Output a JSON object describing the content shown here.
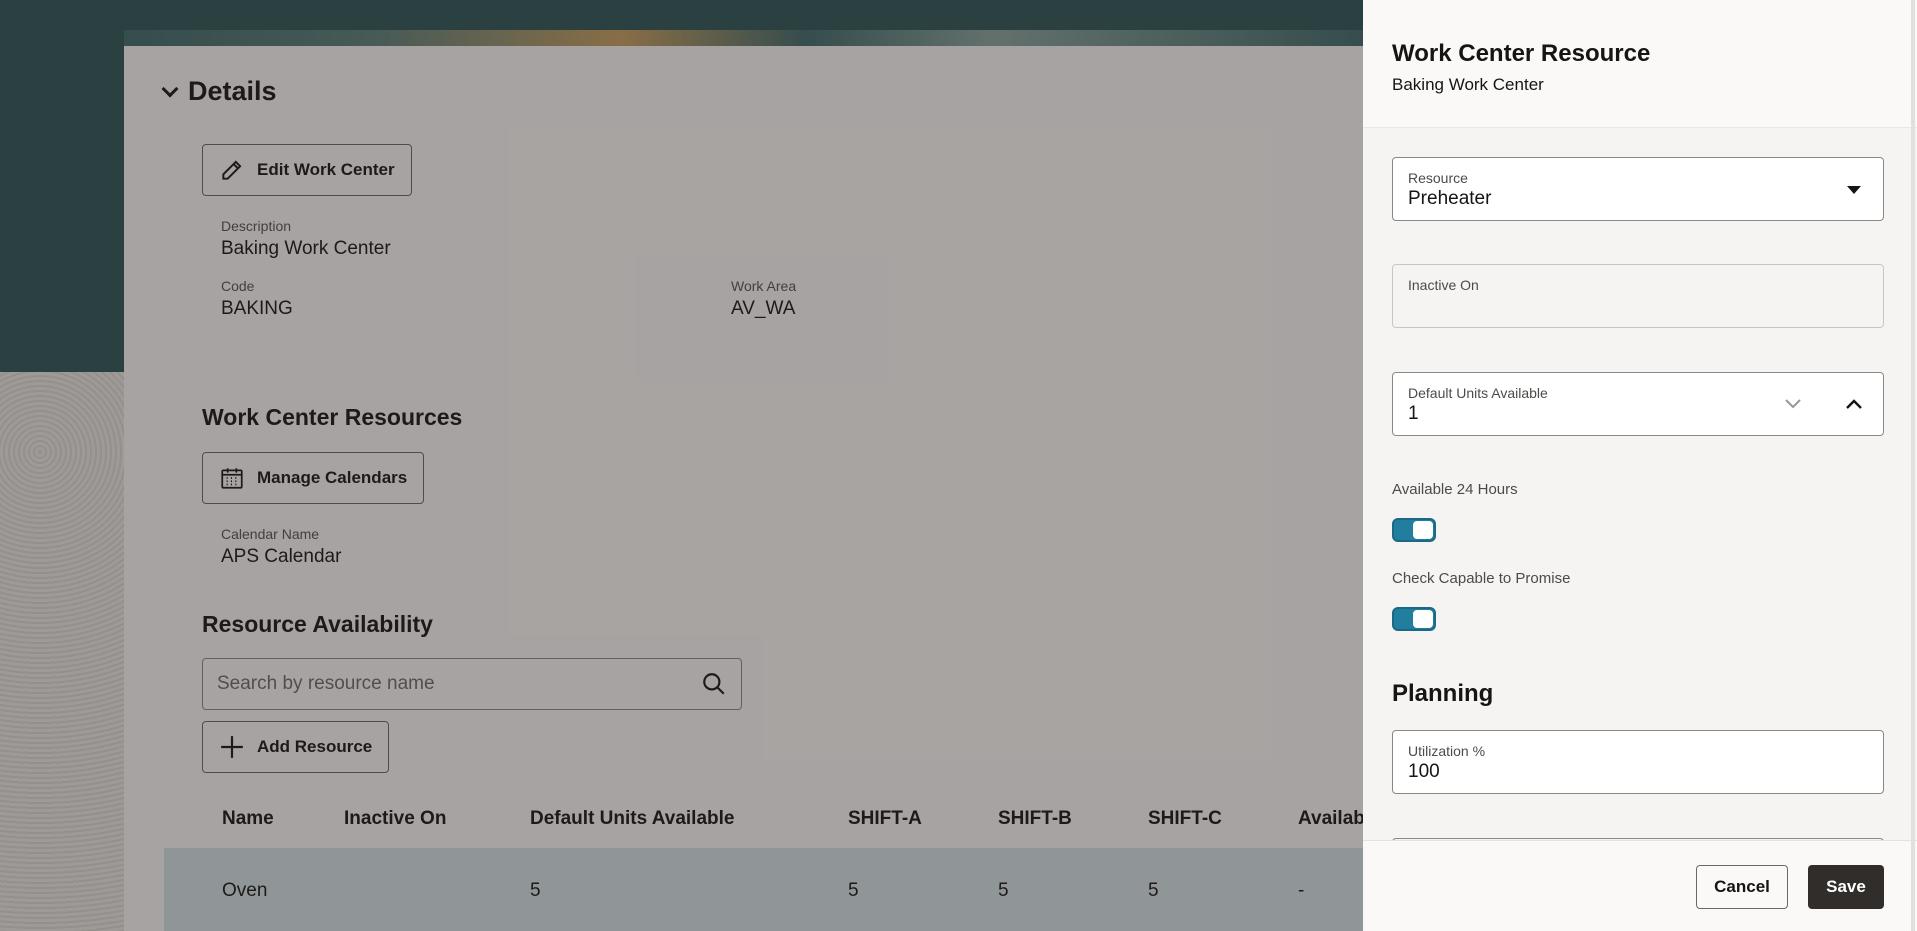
{
  "details": {
    "title": "Details",
    "edit_button": "Edit Work Center",
    "description_label": "Description",
    "description_value": "Baking Work Center",
    "code_label": "Code",
    "code_value": "BAKING",
    "work_area_label": "Work Area",
    "work_area_value": "AV_WA"
  },
  "resources": {
    "title": "Work Center Resources",
    "manage_calendars_button": "Manage Calendars",
    "calendar_label": "Calendar Name",
    "calendar_value": "APS Calendar"
  },
  "availability": {
    "title": "Resource Availability",
    "search_placeholder": "Search by resource name",
    "add_button": "Add Resource",
    "columns": [
      "Name",
      "Inactive On",
      "Default Units Available",
      "SHIFT-A",
      "SHIFT-B",
      "SHIFT-C",
      "Availabl"
    ],
    "rows": [
      {
        "name": "Oven",
        "inactive_on": "",
        "default_units": "5",
        "shift_a": "5",
        "shift_b": "5",
        "shift_c": "5",
        "available": "-"
      }
    ]
  },
  "drawer": {
    "title": "Work Center Resource",
    "subtitle": "Baking Work Center",
    "resource_label": "Resource",
    "resource_value": "Preheater",
    "inactive_label": "Inactive On",
    "inactive_value": "",
    "units_label": "Default Units Available",
    "units_value": "1",
    "available24_label": "Available 24 Hours",
    "available24_on": true,
    "ctp_label": "Check Capable to Promise",
    "ctp_on": true,
    "planning_title": "Planning",
    "utilization_label": "Utilization %",
    "utilization_value": "100",
    "cancel_button": "Cancel",
    "save_button": "Save"
  },
  "colors": {
    "header_teal": "#2d5457",
    "toggle_on": "#227e9e",
    "save_button": "#312d2a",
    "selected_row": "#d6e3e8"
  },
  "icons": [
    "chevron-down-icon",
    "pencil-icon",
    "calendar-icon",
    "search-icon",
    "plus-icon",
    "dropdown-caret-icon",
    "stepper-down-icon",
    "stepper-up-icon"
  ]
}
